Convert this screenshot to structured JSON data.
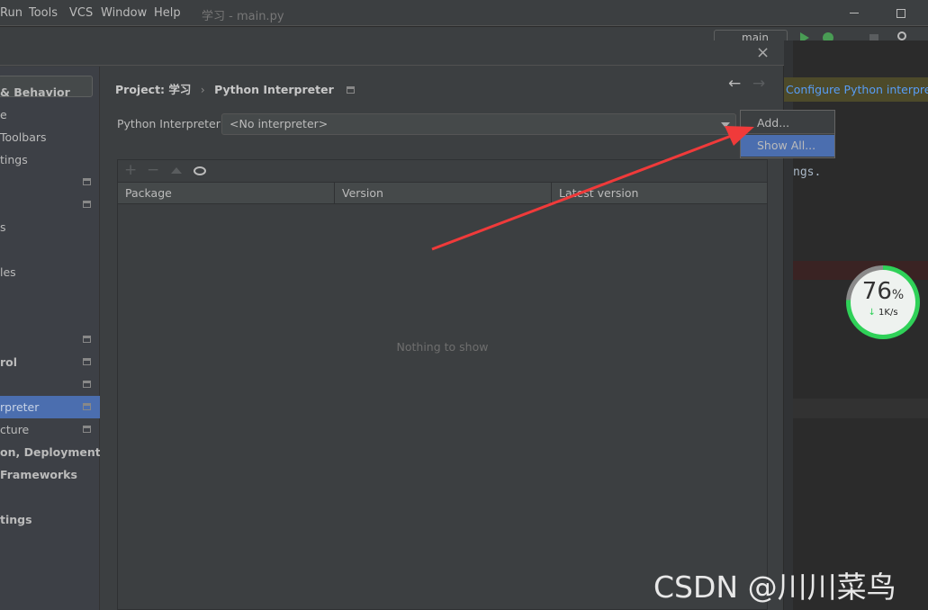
{
  "menubar": {
    "items": [
      "Run",
      "Tools",
      "VCS",
      "Window",
      "Help"
    ],
    "title": "学习 - main.py"
  },
  "toolbar": {
    "run_config": "main"
  },
  "sidebar": {
    "items": [
      {
        "label": "& Behavior",
        "bold": true
      },
      {
        "label": "e"
      },
      {
        "label": " Toolbars"
      },
      {
        "label": "tings"
      },
      {
        "label": "",
        "icon": true
      },
      {
        "label": "",
        "icon": true
      },
      {
        "label": "s"
      },
      {
        "label": ""
      },
      {
        "label": "les"
      },
      {
        "label": ""
      },
      {
        "label": ""
      },
      {
        "label": "",
        "icon": true
      },
      {
        "label": "rol",
        "bold": true,
        "icon": true
      },
      {
        "label": "",
        "icon": true
      },
      {
        "label": "rpreter",
        "icon": true,
        "selected": true
      },
      {
        "label": "cture",
        "icon": true
      },
      {
        "label": "on, Deployment",
        "bold": true
      },
      {
        "label": " Frameworks",
        "bold": true
      },
      {
        "label": ""
      },
      {
        "label": "tings",
        "bold": true
      }
    ]
  },
  "breadcrumb": {
    "project": "Project: 学习",
    "separator": "›",
    "page": "Python Interpreter"
  },
  "interpreter": {
    "label": "Python Interpreter:",
    "value": "<No interpreter>"
  },
  "popup": {
    "items": [
      "Add...",
      "Show All..."
    ],
    "selected": 1
  },
  "table": {
    "columns": [
      "Package",
      "Version",
      "Latest version"
    ],
    "empty_text": "Nothing to show"
  },
  "editor": {
    "banner": "Configure Python interpreter",
    "code_fragment": "ngs."
  },
  "speed_widget": {
    "percent": "76",
    "unit": "%",
    "rate": "1K/s",
    "value": 76
  },
  "watermark": "CSDN @川川菜鸟",
  "colors": {
    "accent": "#4b6eaf",
    "arrow": "#f03a3a",
    "banner": "#4d4a2a",
    "widget_green": "#2fd158"
  }
}
